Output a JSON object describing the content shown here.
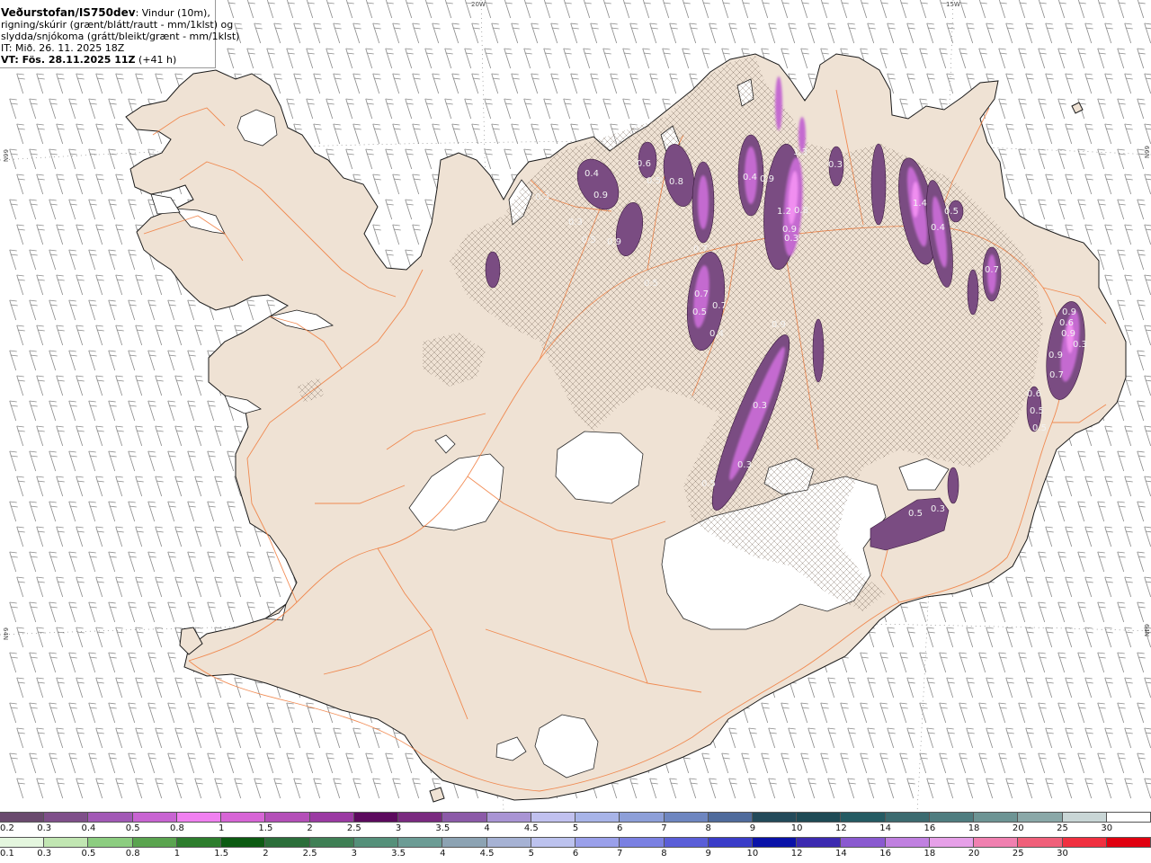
{
  "header": {
    "model": "Veðurstofan/IS750dev",
    "desc_line1": ": Vindur (10m),",
    "desc_line2": "rigning/skúrir (grænt/blátt/rautt - mm/1klst) og",
    "desc_line3": "slydda/snjókoma (grátt/bleikt/grænt - mm/1klst)",
    "it": "IT: Mið. 26. 11. 2025 18Z",
    "vt": "VT: Fös. 28.11.2025 11Z",
    "lead": "(+41 h)"
  },
  "grid_labels": {
    "lon_20w": "20W",
    "lon_15w": "15W",
    "lat_66n_left": "66N",
    "lat_66n_right": "66N",
    "lat_64n_left": "64N",
    "lat_64n_right": "64N"
  },
  "precip_value_labels": [
    "0.3",
    "0.4",
    "0.9",
    "0.3",
    "0.5",
    "0.6",
    "0.9",
    "0.5",
    "0.8",
    "0.4",
    "0.9",
    "1.2",
    "0.8",
    "0.9",
    "0.3",
    "1.3",
    "1.4",
    "0.4",
    "0.5",
    "0.7",
    "0.7",
    "0.7",
    "0.5",
    "0.7",
    "0.5",
    "0.4",
    "0.9",
    "0.3",
    "0.3",
    "0.5",
    "0.5",
    "0.3",
    "0.9",
    "0.6",
    "0.9",
    "0.3",
    "0.9",
    "0.7",
    "0.6",
    "0.5",
    "0.5",
    "0.3"
  ],
  "scale_snow": {
    "labels": [
      "0.2",
      "0.3",
      "0.4",
      "0.5",
      "0.8",
      "1",
      "1.5",
      "2",
      "2.5",
      "3",
      "3.5",
      "4",
      "4.5",
      "5",
      "6",
      "7",
      "8",
      "9",
      "10",
      "12",
      "14",
      "16",
      "18",
      "20",
      "25",
      "30"
    ],
    "colors": [
      "#6a4a6e",
      "#7f4f8a",
      "#a259b6",
      "#c864d2",
      "#f080f0",
      "#d765d6",
      "#b44fb8",
      "#9b3aa3",
      "#5c0a5e",
      "#7a2a80",
      "#8c5aa8",
      "#a994d4",
      "#c1c1ef",
      "#a8b4e8",
      "#8d9fd8",
      "#6e86c0",
      "#4f6b9c",
      "#234a5a",
      "#1e4a55",
      "#255b63",
      "#3c6b70",
      "#4f7d80",
      "#6d9494",
      "#8aa8a8",
      "#c9d6d6",
      "#ffffff"
    ]
  },
  "scale_rain": {
    "labels": [
      "0.1",
      "0.3",
      "0.5",
      "0.8",
      "1",
      "1.5",
      "2",
      "2.5",
      "3",
      "3.5",
      "4",
      "4.5",
      "5",
      "6",
      "7",
      "8",
      "9",
      "10",
      "12",
      "14",
      "16",
      "18",
      "20",
      "25",
      "30"
    ],
    "colors": [
      "#e4f6de",
      "#c1e6b2",
      "#8ccd80",
      "#5aa44f",
      "#2d7d2d",
      "#0c5a12",
      "#2b6e3a",
      "#3f7f55",
      "#55907a",
      "#6c9c95",
      "#8ca3b3",
      "#a6b2d4",
      "#bcc2ee",
      "#9aa0ea",
      "#7a80e2",
      "#5a5ed8",
      "#3a3cc8",
      "#0a12a8",
      "#3c2ab0",
      "#8a5ad0",
      "#c080e0",
      "#e6a0e8",
      "#f080b0",
      "#f0607a",
      "#f03040",
      "#e00010"
    ]
  }
}
